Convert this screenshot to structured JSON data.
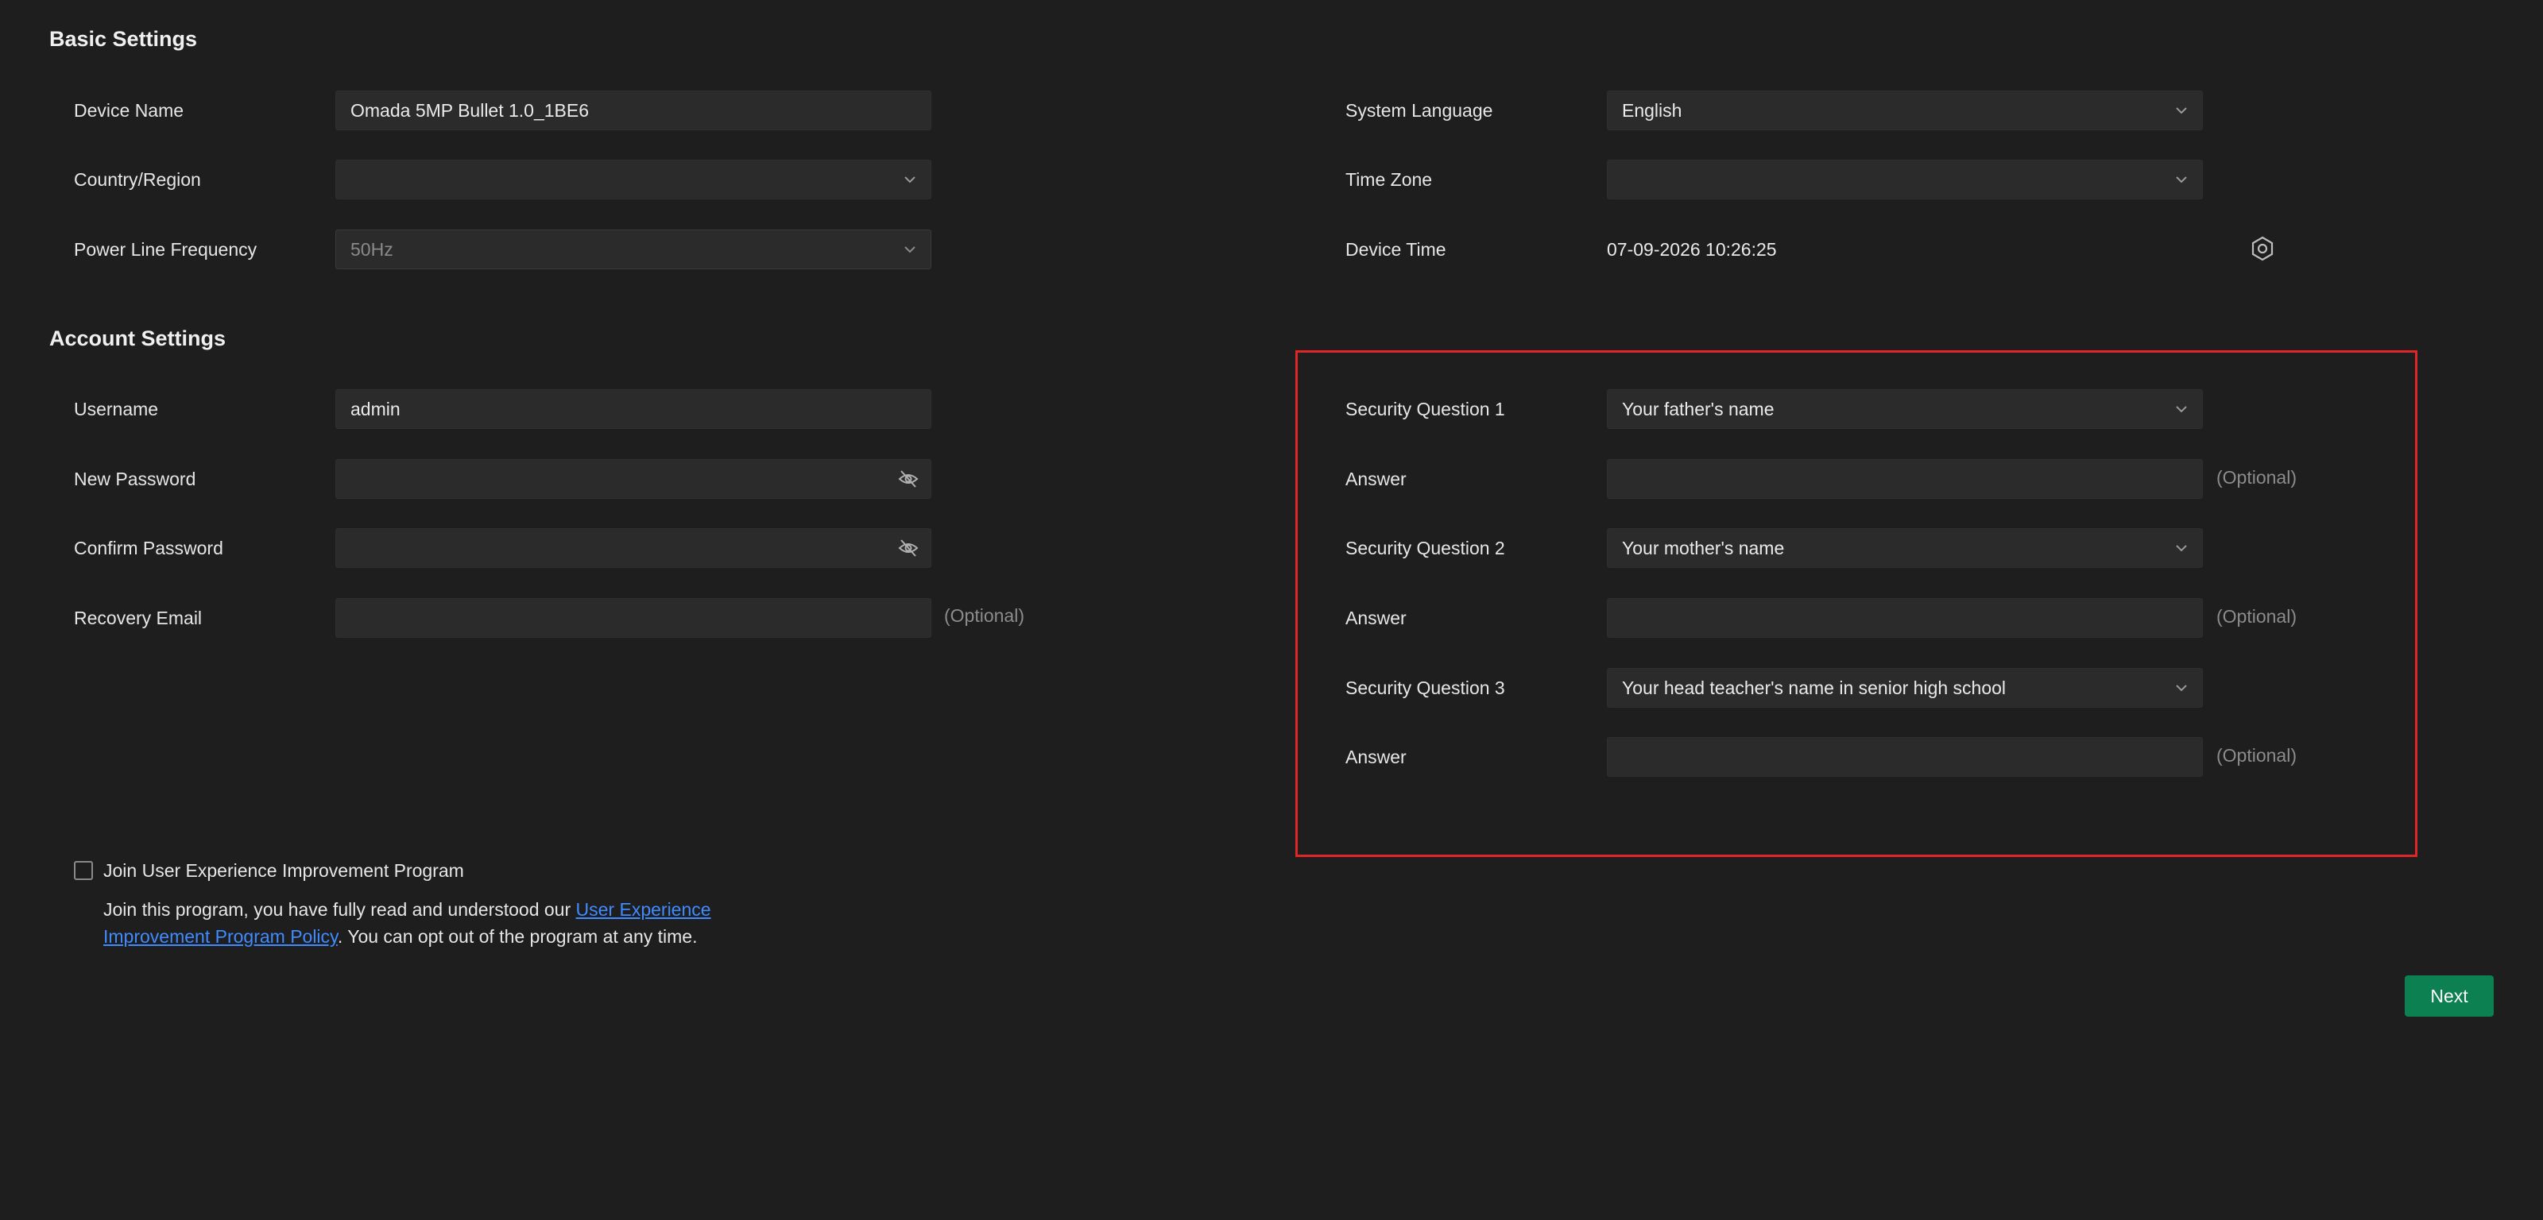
{
  "basic_settings": {
    "title": "Basic Settings",
    "device_name": {
      "label": "Device Name",
      "value": "Omada 5MP Bullet 1.0_1BE6"
    },
    "country_region": {
      "label": "Country/Region",
      "value": ""
    },
    "power_line_frequency": {
      "label": "Power Line Frequency",
      "value": "50Hz"
    },
    "system_language": {
      "label": "System Language",
      "value": "English"
    },
    "time_zone": {
      "label": "Time Zone",
      "value": ""
    },
    "device_time": {
      "label": "Device Time",
      "value": "07-09-2026 10:26:25"
    }
  },
  "account_settings": {
    "title": "Account Settings",
    "username": {
      "label": "Username",
      "value": "admin"
    },
    "new_password": {
      "label": "New Password",
      "value": ""
    },
    "confirm_password": {
      "label": "Confirm Password",
      "value": ""
    },
    "recovery_email": {
      "label": "Recovery Email",
      "value": "",
      "optional": "(Optional)"
    }
  },
  "security": {
    "q1": {
      "label": "Security Question 1",
      "value": "Your father's name"
    },
    "a1": {
      "label": "Answer",
      "value": "",
      "optional": "(Optional)"
    },
    "q2": {
      "label": "Security Question 2",
      "value": "Your mother's name"
    },
    "a2": {
      "label": "Answer",
      "value": "",
      "optional": "(Optional)"
    },
    "q3": {
      "label": "Security Question 3",
      "value": "Your head teacher's name in senior high school"
    },
    "a3": {
      "label": "Answer",
      "value": "",
      "optional": "(Optional)"
    }
  },
  "program": {
    "checkbox_label": "Join User Experience Improvement Program",
    "checked": false,
    "text_before": "Join this program, you have fully read and understood our ",
    "link_text": "User Experience Improvement Program Policy",
    "text_after": ". You can opt out of the program at any time."
  },
  "actions": {
    "next_label": "Next"
  },
  "colors": {
    "background": "#1e1e1e",
    "field": "#2b2b2b",
    "accent_green": "#0c8050",
    "link_blue": "#3f8bff",
    "highlight_red": "#e0252b"
  },
  "icons": {
    "dropdown": "chevron-down-icon",
    "password_toggle": "eye-off-icon",
    "time_settings": "settings-icon"
  }
}
